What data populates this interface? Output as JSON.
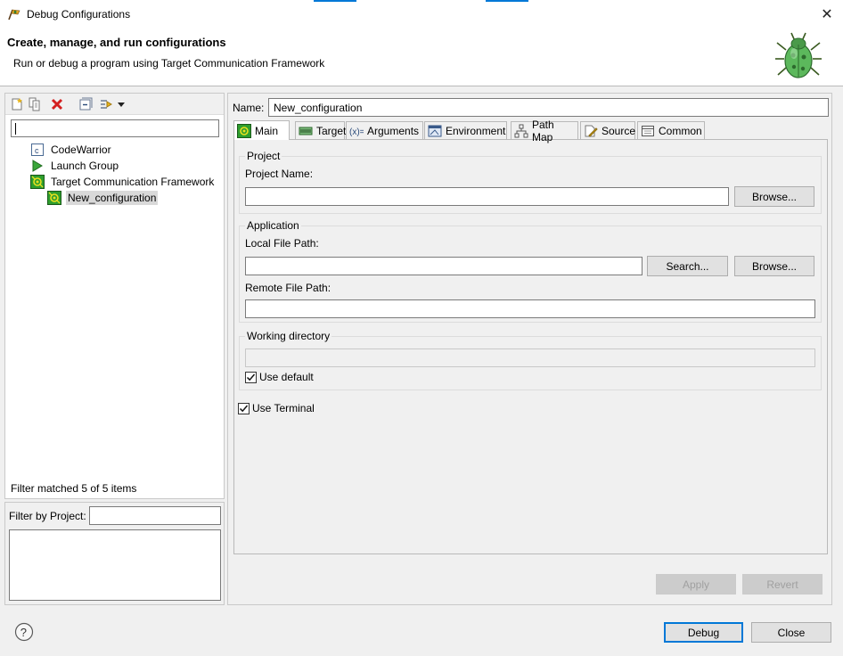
{
  "window": {
    "title": "Debug Configurations",
    "close_glyph": "✕"
  },
  "banner": {
    "title": "Create, manage, and run configurations",
    "subtitle": "Run or debug a program using Target Communication Framework"
  },
  "left": {
    "toolbar": [
      "new-configuration-icon",
      "duplicate-icon",
      "delete-icon",
      "collapse-all-icon",
      "filter-icon",
      "view-menu-icon"
    ],
    "filter_value": "",
    "tree": [
      {
        "label": "CodeWarrior",
        "icon": "codewarrior-icon",
        "indent": 0
      },
      {
        "label": "Launch Group",
        "icon": "launch-group-icon",
        "indent": 0
      },
      {
        "label": "Target Communication Framework",
        "icon": "tcf-icon",
        "indent": 0
      },
      {
        "label": "New_configuration",
        "icon": "tcf-icon",
        "indent": 1,
        "selected": true
      }
    ],
    "filter_matched": "Filter matched 5 of 5 items",
    "filter_by_project_label": "Filter by Project:"
  },
  "right": {
    "name_label": "Name:",
    "name_value": "New_configuration",
    "tabs": [
      {
        "label": "Main",
        "icon": "main-icon",
        "active": true
      },
      {
        "label": "Target",
        "icon": "target-icon"
      },
      {
        "label": "Arguments",
        "icon": "arguments-icon"
      },
      {
        "label": "Environment",
        "icon": "environment-icon"
      },
      {
        "label": "Path Map",
        "icon": "path-map-icon"
      },
      {
        "label": "Source",
        "icon": "source-icon"
      },
      {
        "label": "Common",
        "icon": "common-icon"
      }
    ],
    "project_group": {
      "label": "Project",
      "name_label": "Project Name:",
      "name_value": "",
      "browse": "Browse..."
    },
    "application_group": {
      "label": "Application",
      "local_label": "Local File Path:",
      "local_value": "",
      "search": "Search...",
      "browse": "Browse...",
      "remote_label": "Remote File Path:",
      "remote_value": ""
    },
    "working_dir_group": {
      "label": "Working directory",
      "value": "",
      "use_default_label": "Use default",
      "use_default_checked": true
    },
    "use_terminal_label": "Use Terminal",
    "use_terminal_checked": true,
    "apply": "Apply",
    "revert": "Revert"
  },
  "footer": {
    "debug": "Debug",
    "close": "Close",
    "help_glyph": "?"
  }
}
